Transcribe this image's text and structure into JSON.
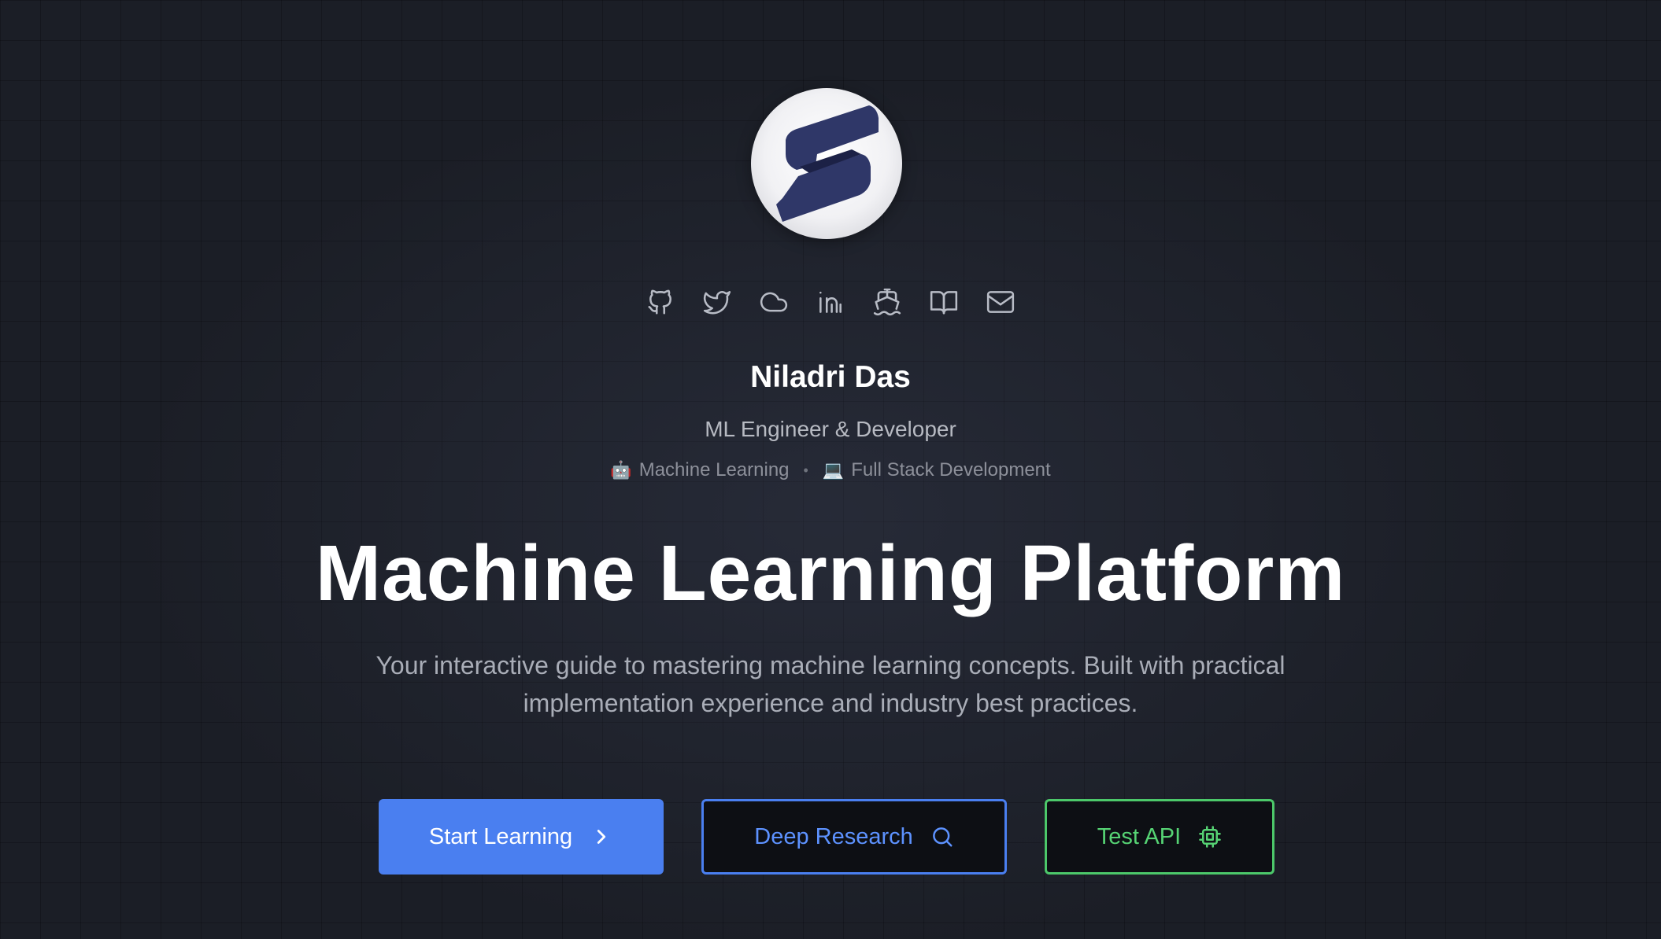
{
  "profile": {
    "logo_alt": "S logo",
    "name": "Niladri Das",
    "role": "ML Engineer & Developer",
    "tags": [
      {
        "emoji": "🤖",
        "label": "Machine Learning"
      },
      {
        "emoji": "💻",
        "label": "Full Stack Development"
      }
    ],
    "separator": "•"
  },
  "social": [
    {
      "name": "github-icon"
    },
    {
      "name": "twitter-icon"
    },
    {
      "name": "cloud-icon"
    },
    {
      "name": "linkedin-icon"
    },
    {
      "name": "ship-icon"
    },
    {
      "name": "book-icon"
    },
    {
      "name": "mail-icon"
    }
  ],
  "hero": {
    "title": "Machine Learning Platform",
    "subtitle": "Your interactive guide to mastering machine learning concepts. Built with practical implementation experience and industry best practices."
  },
  "buttons": {
    "start": {
      "label": "Start Learning",
      "icon": "chevron-right-icon"
    },
    "research": {
      "label": "Deep Research",
      "icon": "search-icon"
    },
    "api": {
      "label": "Test API",
      "icon": "cpu-icon"
    }
  },
  "colors": {
    "background": "#1b1e26",
    "primary": "#4a7ff0",
    "success": "#4cc86a",
    "logo_band": "#2e3566"
  }
}
